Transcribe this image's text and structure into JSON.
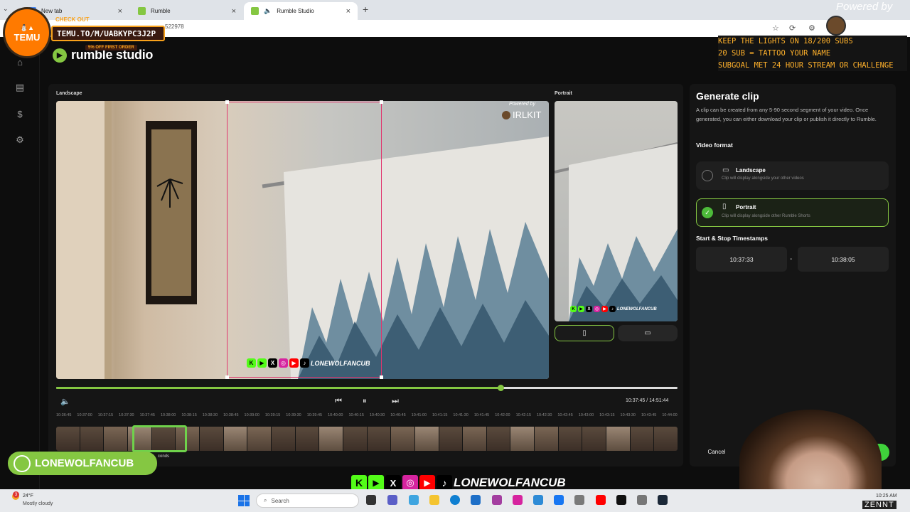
{
  "browser": {
    "tabs": [
      {
        "label": "New tab",
        "favicon_color": "#4285f4"
      },
      {
        "label": "Rumble",
        "favicon_color": "#85c742"
      },
      {
        "label": "Rumble Studio",
        "favicon_color": "#85c742"
      }
    ],
    "url_fragment": "522978"
  },
  "brand": {
    "name": "rumble studio",
    "accent": "#85c742"
  },
  "sidebar": {
    "icons": [
      "home-icon",
      "book-icon",
      "dollar-icon",
      "settings-icon"
    ]
  },
  "editor": {
    "landscape_label": "Landscape",
    "portrait_label": "Portrait",
    "watermark_powered": "Powered by",
    "watermark_brand": "IRLKIT",
    "social_handle": "LONEWOLFANCUB",
    "timecode": "10:37:45 / 14:51:44",
    "progress_fraction": 0.715,
    "timeline_ticks": [
      "10:36:45",
      "10:37:00",
      "10:37:15",
      "10:37:30",
      "10:37:45",
      "10:38:00",
      "10:38:15",
      "10:38:30",
      "10:38:45",
      "10:39:00",
      "10:39:15",
      "10:39:30",
      "10:39:45",
      "10:40:00",
      "10:40:15",
      "10:40:30",
      "10:40:45",
      "10:41:00",
      "10:41:15",
      "10:41:30",
      "10:41:45",
      "10:42:00",
      "10:42:15",
      "10:42:30",
      "10:42:45",
      "10:43:00",
      "10:43:15",
      "10:43:30",
      "10:43:45",
      "10:44:00"
    ],
    "selection_caption": "conds"
  },
  "panel": {
    "title": "Generate clip",
    "description": "A clip can be created from any 5-90 second segment of your video. Once generated, you can either download your clip or publish it directly to Rumble.",
    "video_format_title": "Video format",
    "options": [
      {
        "title": "Landscape",
        "desc": "Clip will display alongside your other videos",
        "selected": false
      },
      {
        "title": "Portrait",
        "desc": "Clip will display alongside other Rumble Shorts",
        "selected": true
      }
    ],
    "timestamps_title": "Start & Stop Timestamps",
    "start": "10:37:33",
    "dash": "-",
    "stop": "10:38:05",
    "cancel": "Cancel"
  },
  "overlay": {
    "temu_logo": "TEMU",
    "temu_checkout": "CHECK OUT",
    "temu_code": "TEMU.TO/M/UABKYPC3J2P",
    "temu_off": "5% OFF FIRST ORDER",
    "powered_by": "Powered by",
    "irlkit": "IRLKIT",
    "goals": [
      "KEEP THE LIGHTS ON 18/200 SUBS",
      "20 SUB = TATTOO YOUR NAME",
      "SUBGOAL MET 24 HOUR STREAM OR CHALLENGE"
    ],
    "handle": "LONEWOLFANCUB"
  },
  "taskbar": {
    "weather_temp": "24°F",
    "weather_desc": "Mostly cloudy",
    "weather_badge": "3",
    "search_placeholder": "Search",
    "clock": "10:25 AM",
    "watermark": "ZENNT"
  }
}
